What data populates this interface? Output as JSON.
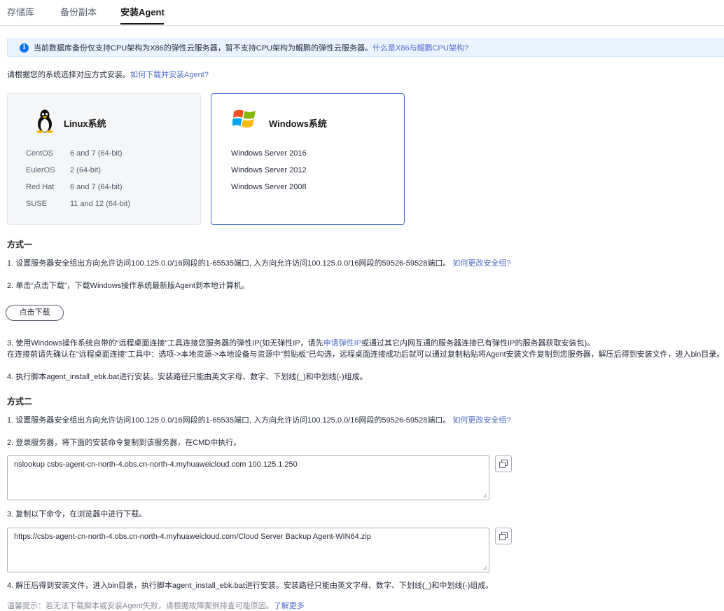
{
  "tabs": [
    {
      "label": "存储库"
    },
    {
      "label": "备份副本"
    },
    {
      "label": "安装Agent"
    }
  ],
  "banner": {
    "text": "当前数据库备份仅支持CPU架构为X86的弹性云服务器，暂不支持CPU架构为鲲鹏的弹性云服务器。",
    "link": "什么是X86与鲲鹏CPU架构?"
  },
  "intro": {
    "text": "请根据您的系统选择对应方式安装。",
    "link": "如何下载并安装Agent?"
  },
  "linux_card": {
    "title": "Linux系统",
    "rows": [
      {
        "name": "CentOS",
        "version": "6 and 7 (64-bit)"
      },
      {
        "name": "EulerOS",
        "version": "2 (64-bit)"
      },
      {
        "name": "Red Hat",
        "version": "6 and 7 (64-bit)"
      },
      {
        "name": "SUSE",
        "version": "11 and 12 (64-bit)"
      }
    ]
  },
  "windows_card": {
    "title": "Windows系统",
    "rows": [
      "Windows Server 2016",
      "Windows Server 2012",
      "Windows Server 2008"
    ]
  },
  "method1": {
    "title": "方式一",
    "step1": {
      "text": "1. 设置服务器安全组出方向允许访问100.125.0.0/16网段的1-65535端口, 入方向允许访问100.125.0.0/16网段的59526-59528端口。",
      "link": "如何更改安全组?"
    },
    "step2": "2. 单击“点击下载”，下载Windows操作系统最新版Agent到本地计算机。",
    "download_button": "点击下载",
    "step3_a": "3.  使用Windows操作系统自带的“远程桌面连接”工具连接您服务器的弹性IP(如无弹性IP，请先",
    "step3_link": "申请弹性IP",
    "step3_b": "或通过其它内网互通的服务器连接已有弹性IP的服务器获取安装包)。",
    "step3_note": "在连接前请先确认在“远程桌面连接”工具中：选项->本地资源->本地设备与资源中“剪贴板”已勾选，远程桌面连接成功后就可以通过复制粘贴将Agent安装文件复制到您服务器，解压后得到安装文件，进入bin目录。",
    "step4": "4. 执行脚本agent_install_ebk.bat进行安装。安装路径只能由英文字母、数字、下划线(_)和中划线(-)组成。"
  },
  "method2": {
    "title": "方式二",
    "step1": {
      "text": "1. 设置服务器安全组出方向允许访问100.125.0.0/16网段的1-65535端口, 入方向允许访问100.125.0.0/16网段的59526-59528端口。",
      "link": "如何更改安全组?"
    },
    "step2": "2. 登录服务器，将下面的安装命令复制到该服务器，在CMD中执行。",
    "command": "nslookup csbs-agent-cn-north-4.obs.cn-north-4.myhuaweicloud.com 100.125.1.250",
    "step3": "3. 复制以下命令，在浏览器中进行下载。",
    "url": "https://csbs-agent-cn-north-4.obs.cn-north-4.myhuaweicloud.com/Cloud Server Backup Agent-WIN64.zip",
    "step4": "4. 解压后得到安装文件，进入bin目录，执行脚本agent_install_ebk.bat进行安装。安装路径只能由英文字母、数字、下划线(_)和中划线(-)组成。"
  },
  "tip": {
    "text": "温馨提示：若无法下载脚本或安装Agent失败，请根据故障案例排查可能原因。",
    "link": "了解更多"
  },
  "colors": {
    "accent": "#526ecc",
    "info": "#0073e5",
    "banner_bg": "#eaf3ff"
  }
}
